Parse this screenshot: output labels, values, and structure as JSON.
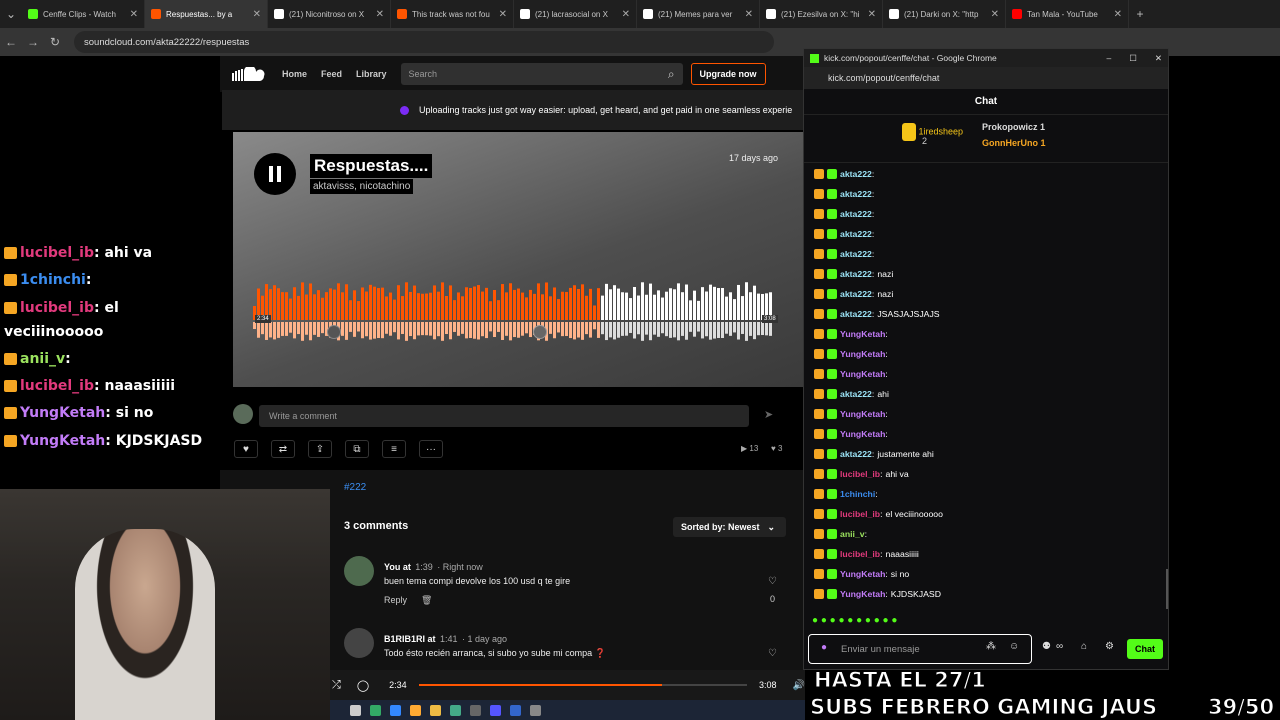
{
  "browser": {
    "tabs": [
      {
        "title": "Cenffe Clips - Watch",
        "color": "#53fc18",
        "active": false
      },
      {
        "title": "Respuestas... by a",
        "color": "#ff5500",
        "active": true
      },
      {
        "title": "(21) Niconitroso on X",
        "color": "#ffffff",
        "active": false
      },
      {
        "title": "This track was not fou",
        "color": "#ff5500",
        "active": false
      },
      {
        "title": "(21) lacrasocial on X",
        "color": "#ffffff",
        "active": false
      },
      {
        "title": "(21) Memes para ver",
        "color": "#ffffff",
        "active": false
      },
      {
        "title": "(21) Ezesilva on X: \"hi",
        "color": "#ffffff",
        "active": false
      },
      {
        "title": "(21) Darki on X: \"http",
        "color": "#ffffff",
        "active": false
      },
      {
        "title": "Tan Mala - YouTube",
        "color": "#ff0000",
        "active": false
      }
    ],
    "url": "soundcloud.com/akta22222/respuestas"
  },
  "overlay_chat": [
    {
      "user": "lucibel_ib",
      "color": "#e23a7d",
      "text": ": ahi va"
    },
    {
      "user": "1chinchi",
      "color": "#3b8df0",
      "text": ":"
    },
    {
      "user": "lucibel_ib",
      "color": "#e23a7d",
      "text": ": el"
    },
    {
      "user": "",
      "color": "#ffffff",
      "text": "veciiinooooo"
    },
    {
      "user": "anii_v",
      "color": "#9be25e",
      "text": ":"
    },
    {
      "user": "lucibel_ib",
      "color": "#e23a7d",
      "text": ": naaasiiiii"
    },
    {
      "user": "YungKetah",
      "color": "#c27cf7",
      "text": ": si no"
    },
    {
      "user": "YungKetah",
      "color": "#c27cf7",
      "text": ": KJDSKJASD"
    }
  ],
  "soundcloud": {
    "nav": [
      "Home",
      "Feed",
      "Library"
    ],
    "search_placeholder": "Search",
    "upgrade": "Upgrade now",
    "banner": "Uploading tracks just got way easier: upload, get heard, and get paid in one seamless experie",
    "track_title": "Respuestas....",
    "track_artists": "aktavisss, nicotachino",
    "track_date": "17 days ago",
    "wave_start": "2:34",
    "wave_end": "3:08",
    "comment_placeholder": "Write a comment",
    "plays": "13",
    "likes": "3",
    "tag": "#222",
    "comments_count": "3 comments",
    "sort": "Sorted by: Newest",
    "comments": [
      {
        "name": "You at",
        "time": "1:39",
        "ago": "· Right now",
        "text": "buen tema compi devolve los 100 usd q te gire",
        "reply": "Reply",
        "likes": "0"
      },
      {
        "name": "B1RIB1RI at",
        "time": "1:41",
        "ago": "· 1 day ago",
        "text": "Todo ésto recién arranca, si subo yo sube mi compa ❓",
        "reply": "",
        "likes": ""
      }
    ],
    "player_elapsed": "2:34",
    "player_total": "3:08",
    "progress": 0.74
  },
  "kick": {
    "window_title": "kick.com/popout/cenffe/chat - Google Chrome",
    "url": "kick.com/popout/cenffe/chat",
    "header": "Chat",
    "leaderboard": [
      {
        "name": "1iredsheep",
        "count": "2"
      },
      {
        "name": "Prokopowicz",
        "count": "1"
      },
      {
        "name": "GonnHerUno",
        "count": "1"
      }
    ],
    "messages": [
      {
        "user": "akta222",
        "color": "#9be2f6",
        "text": ""
      },
      {
        "user": "akta222",
        "color": "#9be2f6",
        "text": ""
      },
      {
        "user": "akta222",
        "color": "#9be2f6",
        "text": ""
      },
      {
        "user": "akta222",
        "color": "#9be2f6",
        "text": ""
      },
      {
        "user": "akta222",
        "color": "#9be2f6",
        "text": ""
      },
      {
        "user": "akta222",
        "color": "#9be2f6",
        "text": "nazi"
      },
      {
        "user": "akta222",
        "color": "#9be2f6",
        "text": "nazi"
      },
      {
        "user": "akta222",
        "color": "#9be2f6",
        "text": "JSASJAJSJAJS"
      },
      {
        "user": "YungKetah",
        "color": "#c27cf7",
        "text": ""
      },
      {
        "user": "YungKetah",
        "color": "#c27cf7",
        "text": ""
      },
      {
        "user": "YungKetah",
        "color": "#c27cf7",
        "text": ""
      },
      {
        "user": "akta222",
        "color": "#9be2f6",
        "text": "ahi"
      },
      {
        "user": "YungKetah",
        "color": "#c27cf7",
        "text": ""
      },
      {
        "user": "YungKetah",
        "color": "#c27cf7",
        "text": ""
      },
      {
        "user": "akta222",
        "color": "#9be2f6",
        "text": "justamente ahi"
      },
      {
        "user": "lucibel_ib",
        "color": "#e23a7d",
        "text": "ahi va"
      },
      {
        "user": "1chinchi",
        "color": "#3b8df0",
        "text": ""
      },
      {
        "user": "lucibel_ib",
        "color": "#e23a7d",
        "text": "el veciiinooooo"
      },
      {
        "user": "anii_v",
        "color": "#9be25e",
        "text": ""
      },
      {
        "user": "lucibel_ib",
        "color": "#e23a7d",
        "text": "naaasiiiii"
      },
      {
        "user": "YungKetah",
        "color": "#c27cf7",
        "text": "si no"
      },
      {
        "user": "YungKetah",
        "color": "#c27cf7",
        "text": "KJDSKJASD"
      }
    ],
    "input_placeholder": "Enviar un mensaje",
    "send": "Chat"
  },
  "overlay": {
    "line1": "HASTA EL 27/1",
    "line2": "SUBS FEBRERO GAMING JAUS",
    "counter": "39/50"
  }
}
